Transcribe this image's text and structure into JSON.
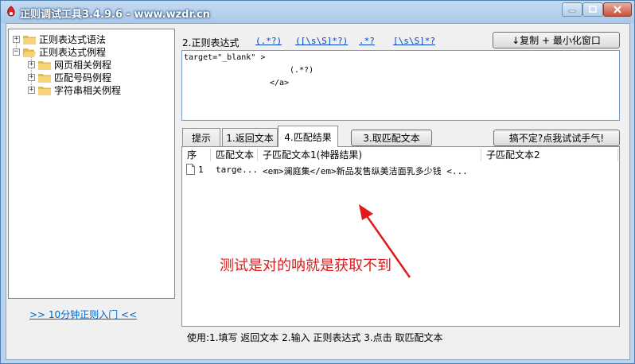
{
  "window": {
    "title": "正则调试工具3.4.9.6 - www.wzdr.cn",
    "minimize_glyph": "—",
    "maximize_glyph": "☐",
    "close_glyph": "✕"
  },
  "tree": {
    "items": [
      {
        "label": "正则表达式语法",
        "expander": "+"
      },
      {
        "label": "正则表达式例程",
        "expander": "−"
      },
      {
        "label": "网页相关例程",
        "expander": "+"
      },
      {
        "label": "匹配号码例程",
        "expander": "+"
      },
      {
        "label": "字符串相关例程",
        "expander": "+"
      }
    ]
  },
  "intro_link": ">> 10分钟正则入门 <<",
  "regex": {
    "label": "2.正则表达式",
    "quick_links": [
      "(.*?)",
      "([\\s\\S]*?)",
      ".*?",
      "[\\s\\S]*?"
    ],
    "copy_button": "↓复制 + 最小化窗口",
    "lines": [
      "target=\"_blank\" >",
      "(.*?)",
      "</a>"
    ]
  },
  "tabs": [
    "提示",
    "1.返回文本",
    "4.匹配结果",
    "3.取匹配文本"
  ],
  "try_button": "搞不定?点我试试手气!",
  "results": {
    "columns": [
      "序",
      "匹配文本",
      "子匹配文本1(神器结果)",
      "子匹配文本2"
    ],
    "rows": [
      {
        "index": "1",
        "match": "targe...",
        "sub1": "<em>澜庭集</em>新品发售纵美洁面乳多少钱 <...",
        "sub2": ""
      }
    ]
  },
  "annotation": "测试是对的呐就是获取不到",
  "usage": "使用:1.填写 返回文本 2.输入 正则表达式 3.点击 取匹配文本",
  "colors": {
    "title_bar": "#b3cfec",
    "annotation_red": "#e0191a",
    "link_blue": "#0066cc"
  }
}
